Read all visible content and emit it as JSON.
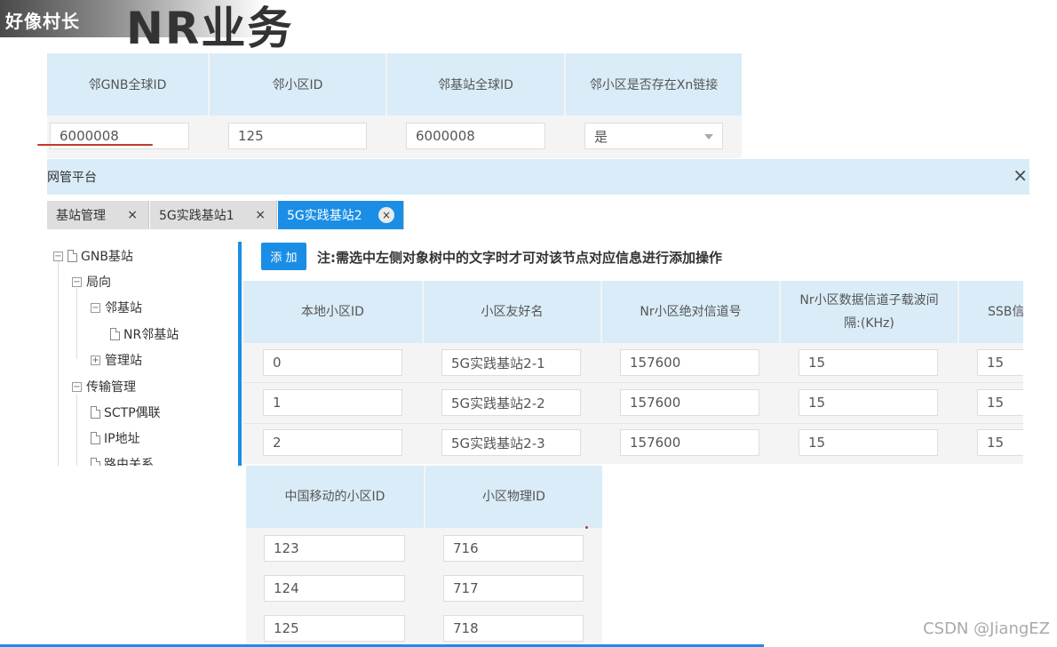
{
  "header": {
    "channel_name": "好像村长",
    "slide_title": "NR业务"
  },
  "neighbor_table": {
    "columns": [
      "邻GNB全球ID",
      "邻小区ID",
      "邻基站全球ID",
      "邻小区是否存在Xn链接"
    ],
    "row": [
      "6000008",
      "125",
      "6000008",
      "是"
    ]
  },
  "window": {
    "title": "网管平台",
    "close_glyph": "×"
  },
  "tabs": [
    {
      "label": "基站管理",
      "close": "×"
    },
    {
      "label": "5G实践基站1",
      "close": "×"
    },
    {
      "label": "5G实践基站2",
      "close": "×",
      "active": true
    }
  ],
  "tree": {
    "nodes": [
      {
        "label": "GNB基站",
        "expander": "−"
      },
      {
        "label": "局向",
        "expander": "−"
      },
      {
        "label": "邻基站",
        "expander": "−"
      },
      {
        "label": "NR邻基站"
      },
      {
        "label": "管理站",
        "expander": "+"
      },
      {
        "label": "传输管理",
        "expander": "−"
      },
      {
        "label": "SCTP偶联"
      },
      {
        "label": "IP地址"
      },
      {
        "label": "路由关系"
      }
    ]
  },
  "toolbar": {
    "add_label": "添 加",
    "note": "注:需选中左侧对象树中的文字时才可对该节点对应信息进行添加操作"
  },
  "cell_table": {
    "columns": [
      "本地小区ID",
      "小区友好名",
      "Nr小区绝对信道号",
      "Nr小区数据信道子载波间隔:(KHz)",
      "SSB信"
    ],
    "rows": [
      [
        "0",
        "5G实践基站2-1",
        "157600",
        "15",
        "15"
      ],
      [
        "1",
        "5G实践基站2-2",
        "157600",
        "15",
        "15"
      ],
      [
        "2",
        "5G实践基站2-3",
        "157600",
        "15",
        "15"
      ]
    ]
  },
  "id_table": {
    "columns": [
      "中国移动的小区ID",
      "小区物理ID"
    ],
    "rows": [
      [
        "123",
        "716"
      ],
      [
        "124",
        "717"
      ],
      [
        "125",
        "718"
      ]
    ]
  },
  "watermark": "CSDN @JiangEZ",
  "colors": {
    "accent": "#1a8ee6",
    "header_bg": "#d9ecf8",
    "annotation_red": "#c0392b"
  }
}
